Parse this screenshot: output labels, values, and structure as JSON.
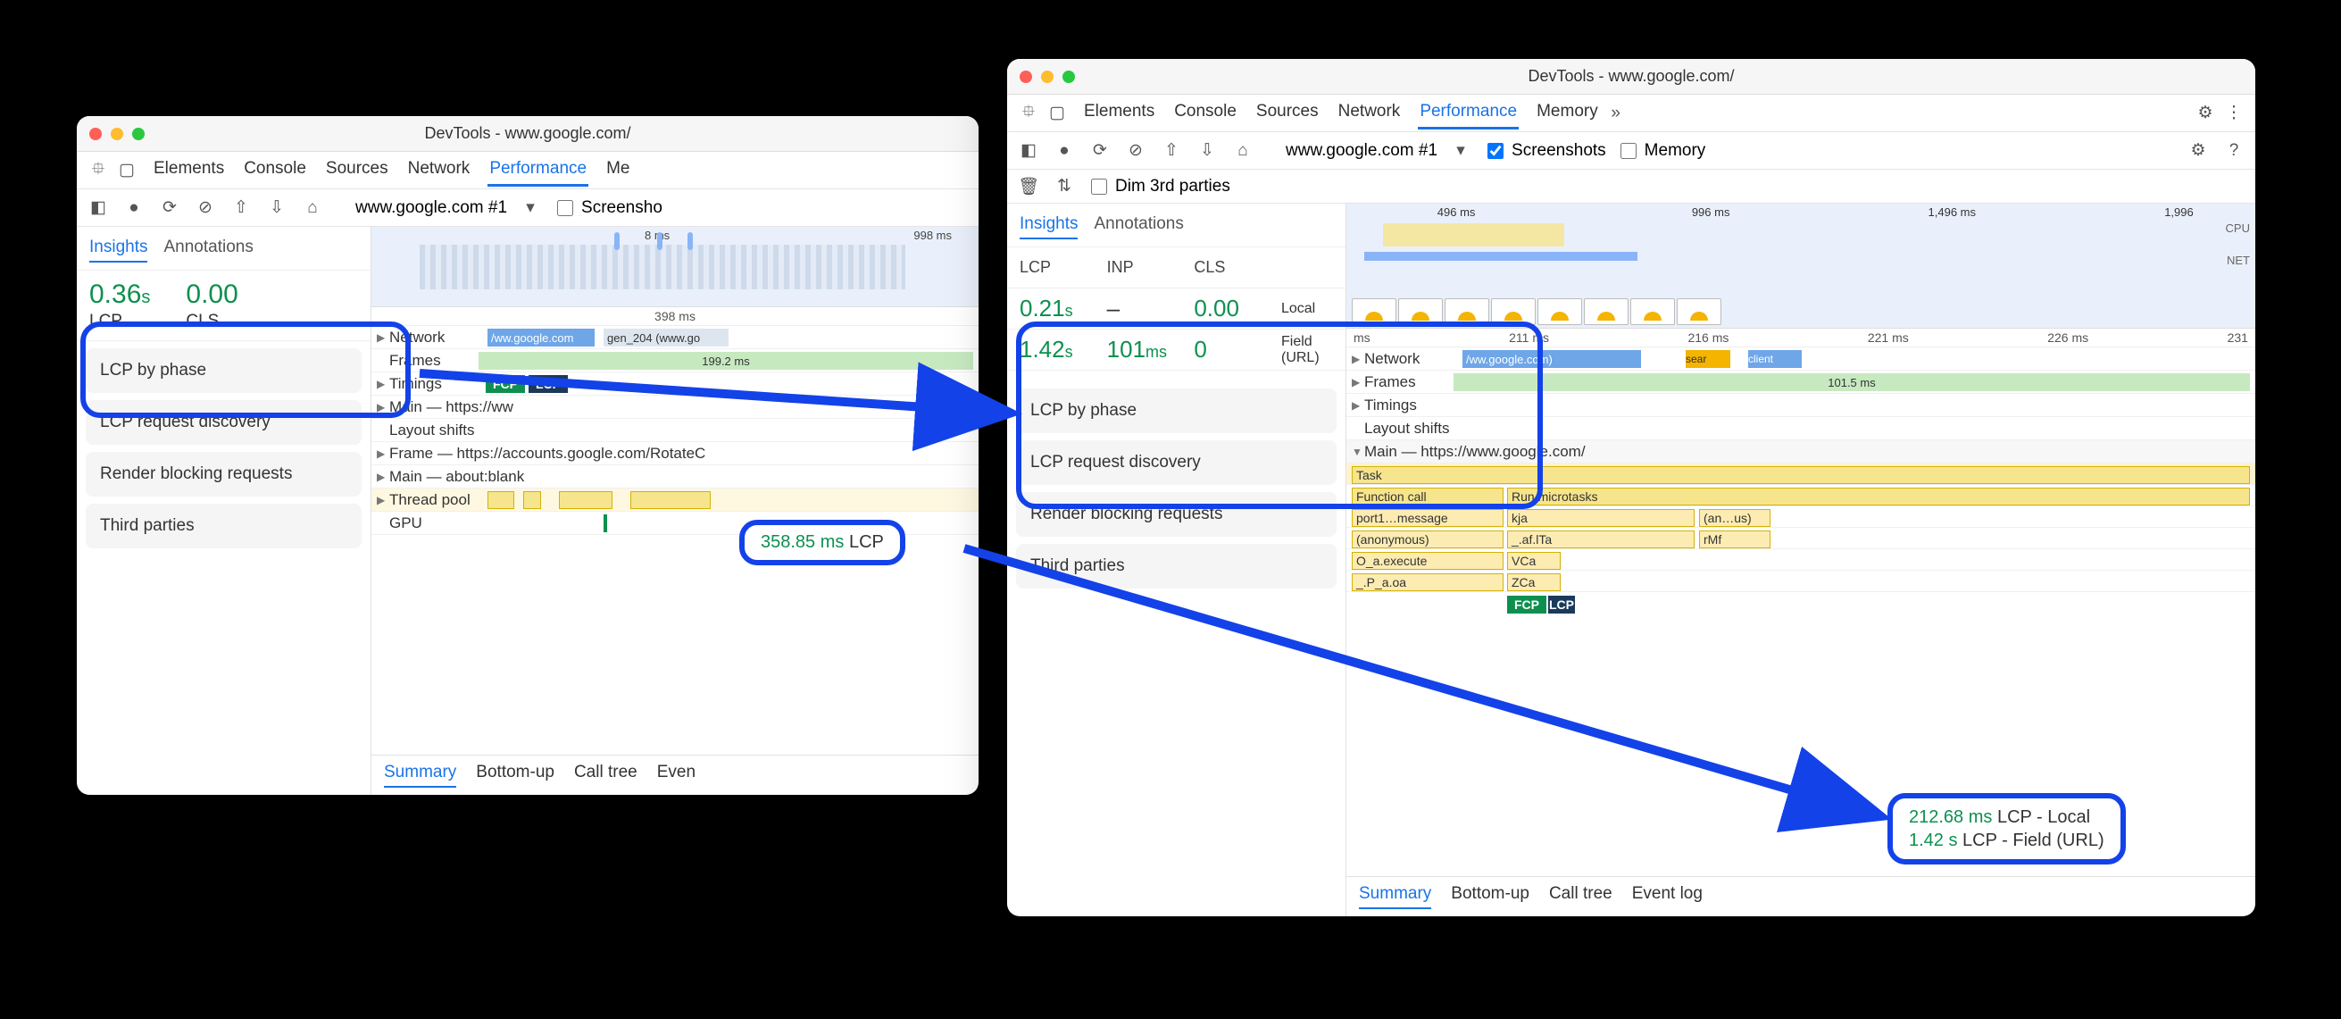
{
  "left": {
    "title": "DevTools - www.google.com/",
    "tabs": [
      "Elements",
      "Console",
      "Sources",
      "Network",
      "Performance",
      "Me"
    ],
    "activeTab": "Performance",
    "select": "www.google.com #1",
    "screenshotChk": false,
    "screenshotLabel": "Screensho",
    "insightTabs": [
      "Insights",
      "Annotations"
    ],
    "activeInsightTab": "Insights",
    "metrics": [
      {
        "value": "0.36",
        "unit": "s",
        "label": "LCP"
      },
      {
        "value": "0.00",
        "unit": "",
        "label": "CLS"
      }
    ],
    "cards": [
      "LCP by phase",
      "LCP request discovery",
      "Render blocking requests",
      "Third parties"
    ],
    "minimapTicks": [
      "8 ms",
      "998 ms"
    ],
    "flameTicks": [
      "398 ms"
    ],
    "tracks": {
      "network": "Network",
      "networkBar1": "/ww.google.com",
      "networkBar2": "gen_204 (www.go",
      "frames": "Frames",
      "framesVal": "199.2 ms",
      "timings": "Timings",
      "fcp": "FCP",
      "lcp": "LCP",
      "main": "Main — https://ww",
      "layout": "Layout shifts",
      "frame2": "Frame — https://accounts.google.com/RotateC",
      "main2": "Main — about:blank",
      "thread": "Thread pool",
      "gpu": "GPU"
    },
    "bottomTabs": [
      "Summary",
      "Bottom-up",
      "Call tree",
      "Even"
    ],
    "activeBottom": "Summary",
    "tooltip": {
      "value": "358.85 ms",
      "label": "LCP"
    }
  },
  "right": {
    "title": "DevTools - www.google.com/",
    "tabs": [
      "Elements",
      "Console",
      "Sources",
      "Network",
      "Performance",
      "Memory"
    ],
    "activeTab": "Performance",
    "select": "www.google.com #1",
    "screenshot": true,
    "screenshotLabel": "Screenshots",
    "memory": false,
    "memoryLabel": "Memory",
    "dim": false,
    "dimLabel": "Dim 3rd parties",
    "insightTabs": [
      "Insights",
      "Annotations"
    ],
    "activeInsightTab": "Insights",
    "headers": [
      "LCP",
      "INP",
      "CLS",
      ""
    ],
    "rows": [
      {
        "lcp": "0.21",
        "lcpUnit": "s",
        "inp": "–",
        "cls": "0.00",
        "src": "Local"
      },
      {
        "lcp": "1.42",
        "lcpUnit": "s",
        "inp": "101",
        "inpUnit": "ms",
        "cls": "0",
        "src": "Field\n(URL)"
      }
    ],
    "cards": [
      "LCP by phase",
      "LCP request discovery",
      "Render blocking requests",
      "Third parties"
    ],
    "minimapTicks": [
      "496 ms",
      "996 ms",
      "1,496 ms",
      "1,996"
    ],
    "cpuLabel": "CPU",
    "netLabel": "NET",
    "flameTicks": [
      "ms",
      "211 ms",
      "216 ms",
      "221 ms",
      "226 ms",
      "231"
    ],
    "tracks": {
      "network": "Network",
      "netBar1": "/ww.google.com)",
      "netBar2": "sear",
      "netBar3": "client",
      "frames": "Frames",
      "framesVal": "101.5 ms",
      "timings": "Timings",
      "layout": "Layout shifts",
      "main": "Main — https://www.google.com/"
    },
    "flame": {
      "r0": "Task",
      "r1a": "Function call",
      "r1b": "Run microtasks",
      "r2a": "port1…message",
      "r2b": "kja",
      "r2c": "(an…us)",
      "r3a": "(anonymous)",
      "r3b": "_.af.lTa",
      "r3c": "rMf",
      "r4a": "O_a.execute",
      "r4b": "VCa",
      "r5a": "_.P_a.oa",
      "r5b": "ZCa",
      "fcp": "FCP",
      "lcp": "LCP"
    },
    "bottomTabs": [
      "Summary",
      "Bottom-up",
      "Call tree",
      "Event log"
    ],
    "activeBottom": "Summary",
    "tooltip": {
      "l1v": "212.68 ms",
      "l1t": "LCP - Local",
      "l2v": "1.42 s",
      "l2t": "LCP - Field (URL)"
    }
  }
}
